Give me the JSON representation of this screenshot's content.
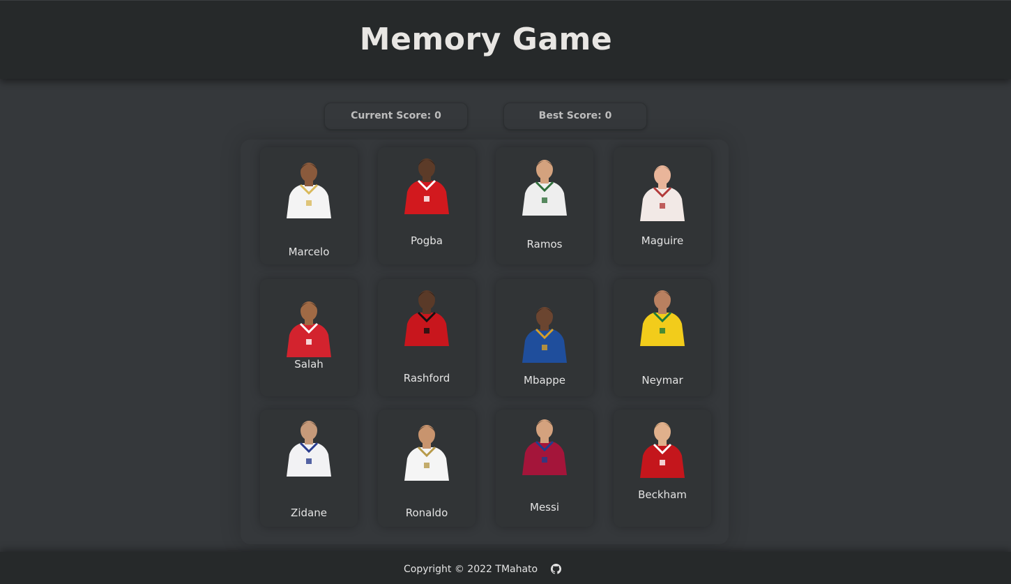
{
  "header": {
    "title": "Memory Game"
  },
  "scoreboard": {
    "current": "Current Score: 0",
    "best": "Best Score: 0"
  },
  "cards": [
    {
      "name": "Marcelo",
      "icon": "player-photo-marcelo",
      "kit": "#f4f4f4",
      "trim": "#d9b95a",
      "skin": "#8a5a3c",
      "hair": "#1b1412"
    },
    {
      "name": "Pogba",
      "icon": "player-photo-pogba",
      "kit": "#d2191e",
      "trim": "#ffffff",
      "skin": "#5c3b28",
      "hair": "#1b1412"
    },
    {
      "name": "Ramos",
      "icon": "player-photo-ramos",
      "kit": "#eeeeee",
      "trim": "#2f6e3a",
      "skin": "#d4a27e",
      "hair": "#3a2c22"
    },
    {
      "name": "Maguire",
      "icon": "player-photo-maguire",
      "kit": "#f2e9e6",
      "trim": "#b23a3a",
      "skin": "#e9b59a",
      "hair": "#8a6a4a"
    },
    {
      "name": "Salah",
      "icon": "player-photo-salah",
      "kit": "#d3232e",
      "trim": "#ffffff",
      "skin": "#a06a45",
      "hair": "#1b1412"
    },
    {
      "name": "Rashford",
      "icon": "player-photo-rashford",
      "kit": "#c8161d",
      "trim": "#111111",
      "skin": "#5a3a28",
      "hair": "#1b1412"
    },
    {
      "name": "Mbappe",
      "icon": "player-photo-mbappe",
      "kit": "#1f4e9c",
      "trim": "#d6a02a",
      "skin": "#6b4530",
      "hair": "#1b1412"
    },
    {
      "name": "Neymar",
      "icon": "player-photo-neymar",
      "kit": "#f2cc1b",
      "trim": "#1f7a3a",
      "skin": "#b98060",
      "hair": "#2a1f18"
    },
    {
      "name": "Zidane",
      "icon": "player-photo-zidane",
      "kit": "#f2f2f4",
      "trim": "#2a3d8f",
      "skin": "#c69a7a",
      "hair": "#3a2c22"
    },
    {
      "name": "Ronaldo",
      "icon": "player-photo-ronaldo",
      "kit": "#f5f5f5",
      "trim": "#b79a4a",
      "skin": "#c8946e",
      "hair": "#1b1412"
    },
    {
      "name": "Messi",
      "icon": "player-photo-messi",
      "kit": "#a4153a",
      "trim": "#1d3f8f",
      "skin": "#d4a27e",
      "hair": "#3a2c22"
    },
    {
      "name": "Beckham",
      "icon": "player-photo-beckham",
      "kit": "#c4161c",
      "trim": "#ffffff",
      "skin": "#e0b08c",
      "hair": "#8a6a3a"
    }
  ],
  "footer": {
    "copyright": "Copyright © 2022 TMahato",
    "icon": "github-icon"
  }
}
